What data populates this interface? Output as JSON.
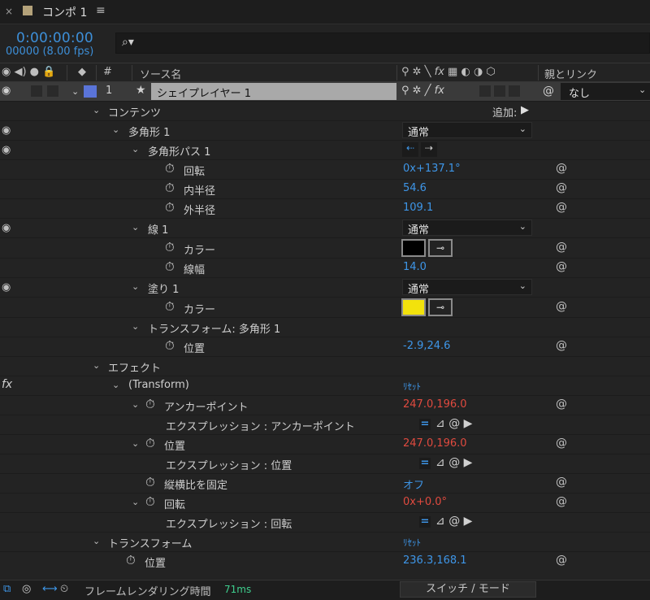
{
  "tab": {
    "close": "×",
    "title": "コンポ 1",
    "menu": "≡"
  },
  "time": {
    "current": "0:00:00:00",
    "frames": "00000 (8.00 fps)"
  },
  "search": {
    "icon": "search-icon"
  },
  "header": {
    "num": "#",
    "source_name": "ソース名",
    "fx": "fx",
    "parent_link": "親とリンク"
  },
  "layer": {
    "number": "1",
    "name": "シェイプレイヤー 1",
    "color": "#5a74d8",
    "parent": "なし"
  },
  "rows": {
    "contents": "コンテンツ",
    "add": "追加:",
    "polygon": "多角形 1",
    "polygon_blend": "通常",
    "polygon_path": "多角形パス 1",
    "rotation_label": "回転",
    "rotation_val_prefix": "0x",
    "rotation_val": "+137.1°",
    "inner_radius_label": "内半径",
    "inner_radius_val": "54.6",
    "outer_radius_label": "外半径",
    "outer_radius_val": "109.1",
    "stroke": "線 1",
    "stroke_blend": "通常",
    "stroke_color_label": "カラー",
    "stroke_color": "#000000",
    "stroke_width_label": "線幅",
    "stroke_width_val": "14.0",
    "fill": "塗り 1",
    "fill_blend": "通常",
    "fill_color_label": "カラー",
    "fill_color": "#f2e20c",
    "transform_poly": "トランスフォーム: 多角形 1",
    "position_label": "位置",
    "position_val": "-2.9,24.6",
    "effects": "エフェクト",
    "transform_fx": "(Transform)",
    "reset": "ﾘｾｯﾄ",
    "anchor_label": "アンカーポイント",
    "anchor_val": "247.0,196.0",
    "expr_anchor": "エクスプレッション : アンカーポイント",
    "pos_label": "位置",
    "pos_val": "247.0,196.0",
    "expr_pos": "エクスプレッション : 位置",
    "aspect_label": "縦横比を固定",
    "aspect_val": "オフ",
    "rot_label": "回転",
    "rot_prefix": "0x",
    "rot_val": "+0.0°",
    "expr_rot": "エクスプレッション : 回転",
    "transform": "トランスフォーム",
    "reset2": "ﾘｾｯﾄ",
    "t_pos_label": "位置",
    "t_pos_val": "236.3,168.1"
  },
  "footer": {
    "render_label": "フレームレンダリング時間",
    "render_ms": "71ms",
    "switch": "スイッチ / モード"
  }
}
